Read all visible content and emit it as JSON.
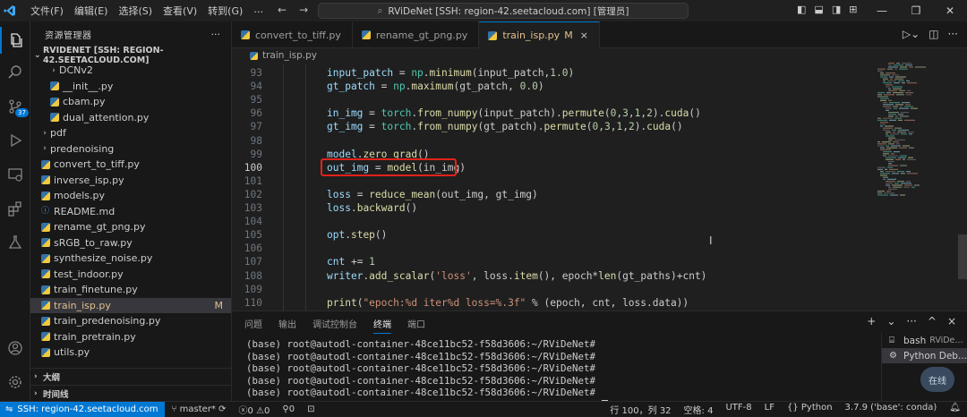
{
  "titlebar": {
    "menu": [
      "文件(F)",
      "编辑(E)",
      "选择(S)",
      "查看(V)",
      "转到(G)"
    ],
    "more": "…",
    "search_text": "RViDeNet [SSH: region-42.seetacloud.com] [管理员]"
  },
  "activitybar": {
    "items": [
      "files-icon",
      "search-icon",
      "source-control-icon",
      "run-debug-icon",
      "remote-explorer-icon",
      "extensions-icon",
      "testing-icon"
    ],
    "scm_badge": "37"
  },
  "sidebar": {
    "title": "资源管理器",
    "more": "···",
    "root": "RVIDENET [SSH: REGION-42.SEETACLOUD.COM]",
    "items": [
      {
        "label": "DCNv2",
        "kind": "folder",
        "indent": 2,
        "chev": "›"
      },
      {
        "label": "__init__.py",
        "kind": "py",
        "indent": 2
      },
      {
        "label": "cbam.py",
        "kind": "py",
        "indent": 2
      },
      {
        "label": "dual_attention.py",
        "kind": "py",
        "indent": 2
      },
      {
        "label": "pdf",
        "kind": "folder",
        "indent": 1,
        "chev": "›"
      },
      {
        "label": "predenoising",
        "kind": "folder",
        "indent": 1,
        "chev": "›"
      },
      {
        "label": "convert_to_tiff.py",
        "kind": "py",
        "indent": 1
      },
      {
        "label": "inverse_isp.py",
        "kind": "py",
        "indent": 1
      },
      {
        "label": "models.py",
        "kind": "py",
        "indent": 1
      },
      {
        "label": "README.md",
        "kind": "md",
        "indent": 1
      },
      {
        "label": "rename_gt_png.py",
        "kind": "py",
        "indent": 1
      },
      {
        "label": "sRGB_to_raw.py",
        "kind": "py",
        "indent": 1
      },
      {
        "label": "synthesize_noise.py",
        "kind": "py",
        "indent": 1
      },
      {
        "label": "test_indoor.py",
        "kind": "py",
        "indent": 1
      },
      {
        "label": "train_finetune.py",
        "kind": "py",
        "indent": 1
      },
      {
        "label": "train_isp.py",
        "kind": "py",
        "indent": 1,
        "selected": true,
        "status": "M"
      },
      {
        "label": "train_predenoising.py",
        "kind": "py",
        "indent": 1
      },
      {
        "label": "train_pretrain.py",
        "kind": "py",
        "indent": 1
      },
      {
        "label": "utils.py",
        "kind": "py",
        "indent": 1
      }
    ],
    "outline": "大纲",
    "timeline": "时间线"
  },
  "editor": {
    "tabs": [
      {
        "label": "convert_to_tiff.py",
        "active": false
      },
      {
        "label": "rename_gt_png.py",
        "active": false
      },
      {
        "label": "train_isp.py",
        "active": true,
        "modified": "M",
        "close": "×"
      }
    ],
    "breadcrumb": "train_isp.py",
    "actions": [
      "run-icon",
      "split-editor-icon",
      "more-icon"
    ],
    "current_line": "100",
    "lines": [
      {
        "n": "93",
        "tokens": [
          [
            "v",
            "input_patch"
          ],
          [
            "p",
            " = "
          ],
          [
            "c",
            "np"
          ],
          [
            "p",
            "."
          ],
          [
            "f",
            "minimum"
          ],
          [
            "p",
            "(input_patch,"
          ],
          [
            "n",
            "1.0"
          ],
          [
            "p",
            ")"
          ]
        ]
      },
      {
        "n": "94",
        "tokens": [
          [
            "v",
            "gt_patch"
          ],
          [
            "p",
            " = "
          ],
          [
            "c",
            "np"
          ],
          [
            "p",
            "."
          ],
          [
            "f",
            "maximum"
          ],
          [
            "p",
            "(gt_patch, "
          ],
          [
            "n",
            "0.0"
          ],
          [
            "p",
            ")"
          ]
        ]
      },
      {
        "n": "95",
        "tokens": []
      },
      {
        "n": "96",
        "tokens": [
          [
            "v",
            "in_img"
          ],
          [
            "p",
            " = "
          ],
          [
            "c",
            "torch"
          ],
          [
            "p",
            "."
          ],
          [
            "f",
            "from_numpy"
          ],
          [
            "p",
            "(input_patch)."
          ],
          [
            "f",
            "permute"
          ],
          [
            "p",
            "("
          ],
          [
            "n",
            "0"
          ],
          [
            "p",
            ","
          ],
          [
            "n",
            "3"
          ],
          [
            "p",
            ","
          ],
          [
            "n",
            "1"
          ],
          [
            "p",
            ","
          ],
          [
            "n",
            "2"
          ],
          [
            "p",
            ")."
          ],
          [
            "f",
            "cuda"
          ],
          [
            "p",
            "()"
          ]
        ]
      },
      {
        "n": "97",
        "tokens": [
          [
            "v",
            "gt_img"
          ],
          [
            "p",
            " = "
          ],
          [
            "c",
            "torch"
          ],
          [
            "p",
            "."
          ],
          [
            "f",
            "from_numpy"
          ],
          [
            "p",
            "(gt_patch)."
          ],
          [
            "f",
            "permute"
          ],
          [
            "p",
            "("
          ],
          [
            "n",
            "0"
          ],
          [
            "p",
            ","
          ],
          [
            "n",
            "3"
          ],
          [
            "p",
            ","
          ],
          [
            "n",
            "1"
          ],
          [
            "p",
            ","
          ],
          [
            "n",
            "2"
          ],
          [
            "p",
            ")."
          ],
          [
            "f",
            "cuda"
          ],
          [
            "p",
            "()"
          ]
        ]
      },
      {
        "n": "98",
        "tokens": []
      },
      {
        "n": "99",
        "tokens": [
          [
            "v",
            "model"
          ],
          [
            "p",
            "."
          ],
          [
            "f",
            "zero_grad"
          ],
          [
            "p",
            "()"
          ]
        ]
      },
      {
        "n": "100",
        "tokens": [
          [
            "v",
            "out_img"
          ],
          [
            "p",
            " = "
          ],
          [
            "f",
            "model"
          ],
          [
            "p",
            "(in_img)"
          ]
        ]
      },
      {
        "n": "101",
        "tokens": []
      },
      {
        "n": "102",
        "tokens": [
          [
            "v",
            "loss"
          ],
          [
            "p",
            " = "
          ],
          [
            "f",
            "reduce_mean"
          ],
          [
            "p",
            "(out_img, gt_img)"
          ]
        ]
      },
      {
        "n": "103",
        "tokens": [
          [
            "v",
            "loss"
          ],
          [
            "p",
            "."
          ],
          [
            "f",
            "backward"
          ],
          [
            "p",
            "()"
          ]
        ]
      },
      {
        "n": "104",
        "tokens": []
      },
      {
        "n": "105",
        "tokens": [
          [
            "v",
            "opt"
          ],
          [
            "p",
            "."
          ],
          [
            "f",
            "step"
          ],
          [
            "p",
            "()"
          ]
        ]
      },
      {
        "n": "106",
        "tokens": []
      },
      {
        "n": "107",
        "tokens": [
          [
            "v",
            "cnt"
          ],
          [
            "p",
            " += "
          ],
          [
            "n",
            "1"
          ]
        ]
      },
      {
        "n": "108",
        "tokens": [
          [
            "v",
            "writer"
          ],
          [
            "p",
            "."
          ],
          [
            "f",
            "add_scalar"
          ],
          [
            "p",
            "("
          ],
          [
            "s",
            "'loss'"
          ],
          [
            "p",
            ", loss."
          ],
          [
            "f",
            "item"
          ],
          [
            "p",
            "(), epoch*"
          ],
          [
            "f",
            "len"
          ],
          [
            "p",
            "(gt_paths)+cnt)"
          ]
        ]
      },
      {
        "n": "109",
        "tokens": []
      },
      {
        "n": "110",
        "tokens": [
          [
            "f",
            "print"
          ],
          [
            "p",
            "("
          ],
          [
            "s",
            "\"epoch:%d iter%d loss=%.3f\""
          ],
          [
            "p",
            " % (epoch, cnt, loss.data))"
          ]
        ]
      }
    ]
  },
  "panel": {
    "tabs": [
      {
        "label": "问题",
        "active": false
      },
      {
        "label": "输出",
        "active": false
      },
      {
        "label": "调试控制台",
        "active": false
      },
      {
        "label": "终端",
        "active": true
      },
      {
        "label": "端口",
        "active": false
      }
    ],
    "actions": [
      "+",
      "⌄",
      "···",
      "^",
      "×"
    ],
    "terminal_lines": [
      "(base) root@autodl-container-48ce11bc52-f58d3606:~/RViDeNet#",
      "(base) root@autodl-container-48ce11bc52-f58d3606:~/RViDeNet#",
      "(base) root@autodl-container-48ce11bc52-f58d3606:~/RViDeNet#",
      "(base) root@autodl-container-48ce11bc52-f58d3606:~/RViDeNet#",
      "(base) root@autodl-container-48ce11bc52-f58d3606:~/RViDeNet#",
      "(base) root@autodl-container-48ce11bc52-f58d3606:~/RViDeNet# "
    ],
    "terminals": [
      {
        "name": "bash",
        "sub": "RViDe...",
        "active": false
      },
      {
        "name": "Python Deb...",
        "sub": "",
        "active": true
      }
    ],
    "chat_label": "在线"
  },
  "statusbar": {
    "remote": "SSH: region-42.seetacloud.com",
    "branch": "master*",
    "errors": "0",
    "warnings": "0",
    "ports": "0",
    "position": "行 100，列 32",
    "spaces": "空格: 4",
    "encoding": "UTF-8",
    "eol": "LF",
    "language": "Python",
    "interpreter": "3.7.9 ('base': conda)"
  },
  "colors": {
    "accent": "#0078d4",
    "highlight_box": "#e2231a",
    "modified": "#e2c08d"
  }
}
